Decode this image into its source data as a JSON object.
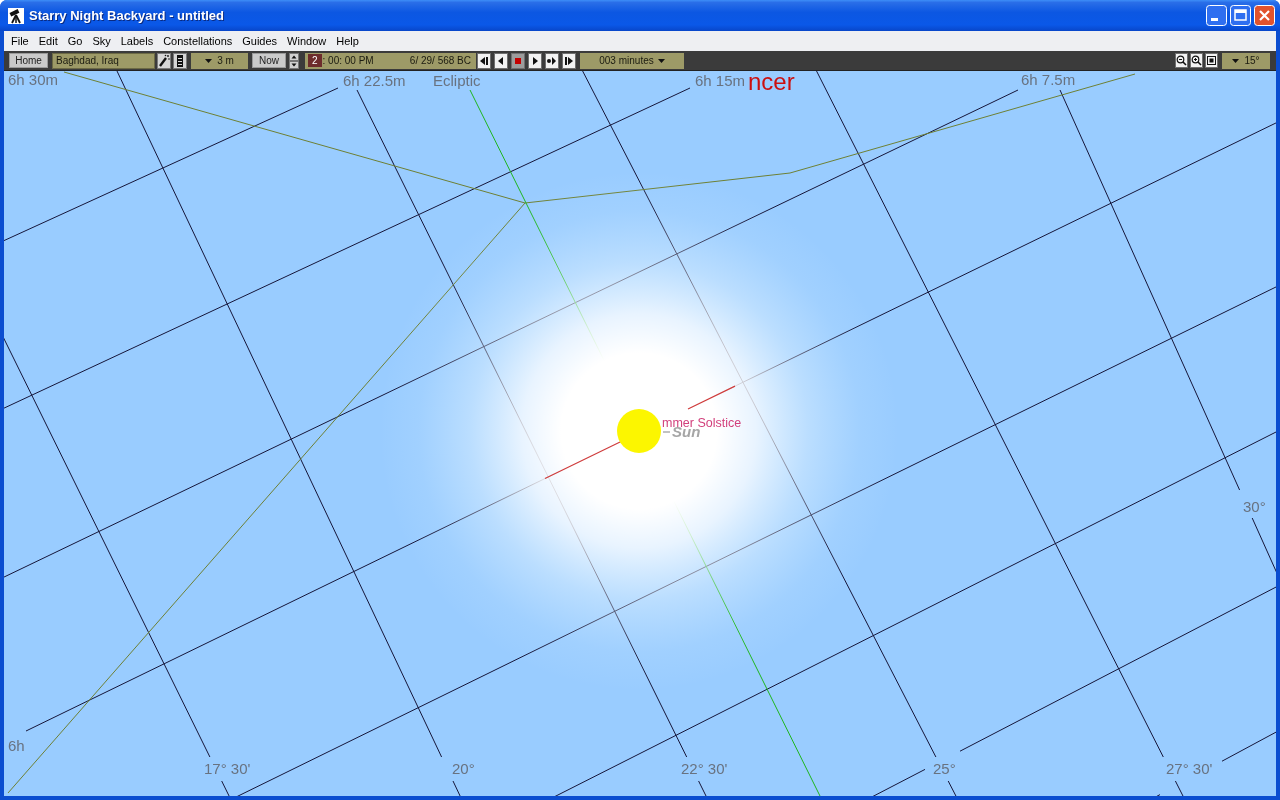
{
  "window": {
    "title": "Starry Night Backyard - untitled"
  },
  "menu": [
    "File",
    "Edit",
    "Go",
    "Sky",
    "Labels",
    "Constellations",
    "Guides",
    "Window",
    "Help"
  ],
  "toolbar": {
    "home_button": "Home",
    "location": "Baghdad, Iraq",
    "elevation": "3 m",
    "now_button": "Now",
    "time_segments": [
      {
        "text": "2",
        "selected": true
      },
      {
        "text": ": 00: 00 PM",
        "selected": false
      }
    ],
    "date": "6/ 29/ 568 BC",
    "playback": [
      {
        "kind": "step-back",
        "selected": false
      },
      {
        "kind": "reverse",
        "selected": false
      },
      {
        "kind": "stop",
        "selected": true
      },
      {
        "kind": "play",
        "selected": false
      },
      {
        "kind": "real-time",
        "selected": false
      },
      {
        "kind": "step-forward",
        "selected": false
      }
    ],
    "time_step": "003 minutes",
    "field_of_view": "15°"
  },
  "sky": {
    "labels": [
      {
        "kind": "grid",
        "text": "6h 30m"
      },
      {
        "kind": "grid",
        "text": "6h 22.5m"
      },
      {
        "kind": "guide",
        "text": "Ecliptic"
      },
      {
        "kind": "grid",
        "text": "6h 15m"
      },
      {
        "kind": "constellation",
        "text": "ncer"
      },
      {
        "kind": "grid",
        "text": "6h 7.5m"
      },
      {
        "kind": "marker",
        "text": "mmer Solstice"
      },
      {
        "kind": "object",
        "text": "Sun"
      },
      {
        "kind": "grid",
        "text": "30°"
      },
      {
        "kind": "grid",
        "text": "6h"
      },
      {
        "kind": "grid",
        "text": "17° 30'"
      },
      {
        "kind": "grid",
        "text": "20°"
      },
      {
        "kind": "grid",
        "text": "22° 30'"
      },
      {
        "kind": "grid",
        "text": "25°"
      },
      {
        "kind": "grid",
        "text": "27° 30'"
      }
    ]
  }
}
